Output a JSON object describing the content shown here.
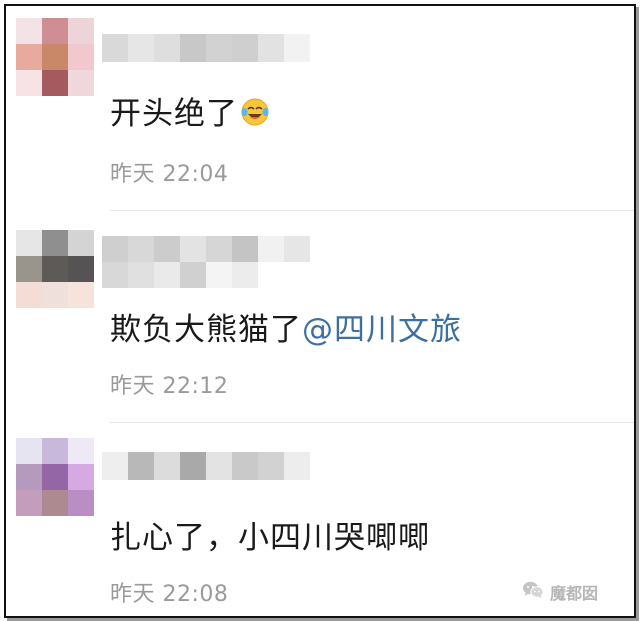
{
  "comments": [
    {
      "text": "开头绝了",
      "emoji": "laughing-crying-emoji",
      "time": "昨天 22:04",
      "avatar_colors": [
        "#f3e3e6",
        "#cf8e93",
        "#ecd4d8",
        "#e8a99e",
        "#c98868",
        "#f0c8cd",
        "#f7e3e6",
        "#a55a60",
        "#efd8dc"
      ],
      "name_colors": [
        "#d9d9d9",
        "#e6e6e6",
        "#dedede",
        "#c8c8c8",
        "#d2d2d2",
        "#cfcfcf",
        "#e2e2e2",
        "#f2f2f2"
      ]
    },
    {
      "text": "欺负大熊猫了",
      "mention": "@四川文旅",
      "time": "昨天 22:12",
      "avatar_colors": [
        "#e6e6e6",
        "#8f8f8f",
        "#d4d4d4",
        "#9a958c",
        "#5d5a58",
        "#555353",
        "#f3ddd5",
        "#efe0db",
        "#f5e3dc"
      ],
      "name_colors": [
        "#cfcfcf",
        "#d8d8d8",
        "#cccccc",
        "#e3e3e3",
        "#d6d6d6",
        "#c4c4c4",
        "#f1f1f1",
        "#e6e6e6",
        "#d8d8d8",
        "#e0e0e0",
        "#eaeaea",
        "#d0d0d0",
        "#f4f4f4",
        "#ececec"
      ]
    },
    {
      "text": "扎心了，小四川哭唧唧",
      "time": "昨天 22:08",
      "avatar_colors": [
        "#e7e4f2",
        "#c7b8dc",
        "#efe9f5",
        "#b59abd",
        "#9566a6",
        "#d6a9e2",
        "#c49dbc",
        "#ad8a8f",
        "#b98ec4"
      ],
      "name_colors": [
        "#eeeeee",
        "#b8b8b8",
        "#dcdcdc",
        "#a9a9a9",
        "#e3e3e3",
        "#c9c9c9",
        "#d2d2d2",
        "#ededed"
      ]
    }
  ],
  "watermark": {
    "label": "魔都囡",
    "icon": "wechat-icon"
  }
}
